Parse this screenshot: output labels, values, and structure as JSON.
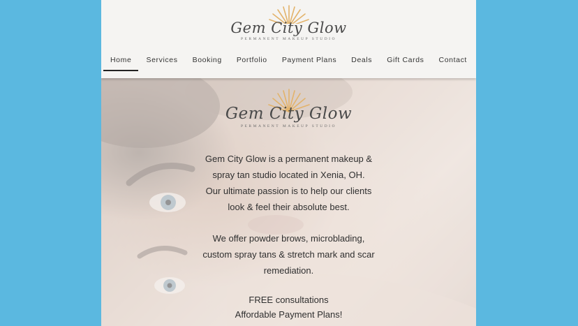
{
  "brand": {
    "name": "Gem City Glow",
    "tagline": "PERMANENT MAKEUP STUDIO",
    "accent": "#e3b36b"
  },
  "nav": {
    "items": [
      "Home",
      "Services",
      "Booking",
      "Portfolio",
      "Payment Plans",
      "Deals",
      "Gift Cards",
      "Contact"
    ],
    "active_index": 0
  },
  "hero": {
    "intro_lines": [
      "Gem City Glow is a permanent makeup &",
      "spray tan studio located in Xenia, OH.",
      "Our ultimate passion is to help our clients",
      "look & feel their absolute best."
    ],
    "offer_lines": [
      "We offer powder brows, microblading,",
      "custom spray tans & stretch mark and scar",
      "remediation."
    ],
    "cta_lines": [
      "FREE consultations",
      "Affordable Payment Plans!"
    ]
  }
}
